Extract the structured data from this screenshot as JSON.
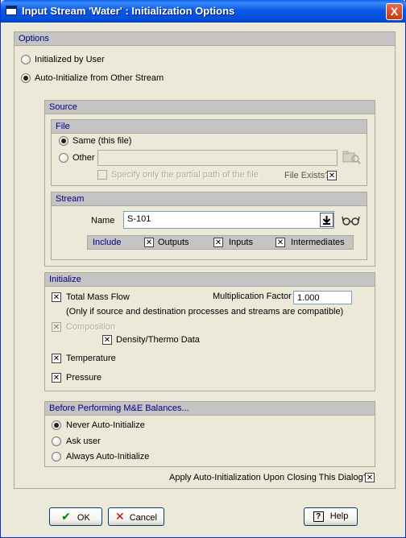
{
  "window": {
    "title": "Input Stream 'Water' : Initialization Options",
    "close_glyph": "X"
  },
  "options": {
    "header": "Options",
    "initialized_by_user": "Initialized by User",
    "auto_initialize": "Auto-Initialize from Other Stream",
    "selected": "auto_initialize"
  },
  "source": {
    "header": "Source",
    "file": {
      "header": "File",
      "same_label": "Same (this file)",
      "other_label": "Other",
      "other_path": "",
      "partial_path_label": "Specify only the partial path of the file",
      "file_exists_label": "File Exists?"
    },
    "stream": {
      "header": "Stream",
      "name_label": "Name",
      "name_value": "S-101",
      "include_label": "Include",
      "outputs_label": "Outputs",
      "inputs_label": "Inputs",
      "intermediates_label": "Intermediates"
    }
  },
  "initialize": {
    "header": "Initialize",
    "total_mass_flow": "Total Mass Flow",
    "multiplication_factor_label": "Multiplication Factor",
    "multiplication_factor_value": "1.000",
    "compat_note": "(Only if source and destination processes and streams are compatible)",
    "composition": "Composition",
    "density_thermo": "Density/Thermo Data",
    "temperature": "Temperature",
    "pressure": "Pressure"
  },
  "before": {
    "header": "Before Performing M&E Balances...",
    "never": "Never Auto-Initialize",
    "ask": "Ask user",
    "always": "Always Auto-Initialize",
    "selected": "never"
  },
  "apply_label": "Apply Auto-Initialization Upon Closing This Dialog?",
  "buttons": {
    "ok": "OK",
    "cancel": "Cancel",
    "help": "Help"
  },
  "colors": {
    "title_bar": "#0a58e6",
    "group_header_bg": "#c4c4c4",
    "group_header_text": "#00007f",
    "dialog_bg": "#ece9d8"
  }
}
